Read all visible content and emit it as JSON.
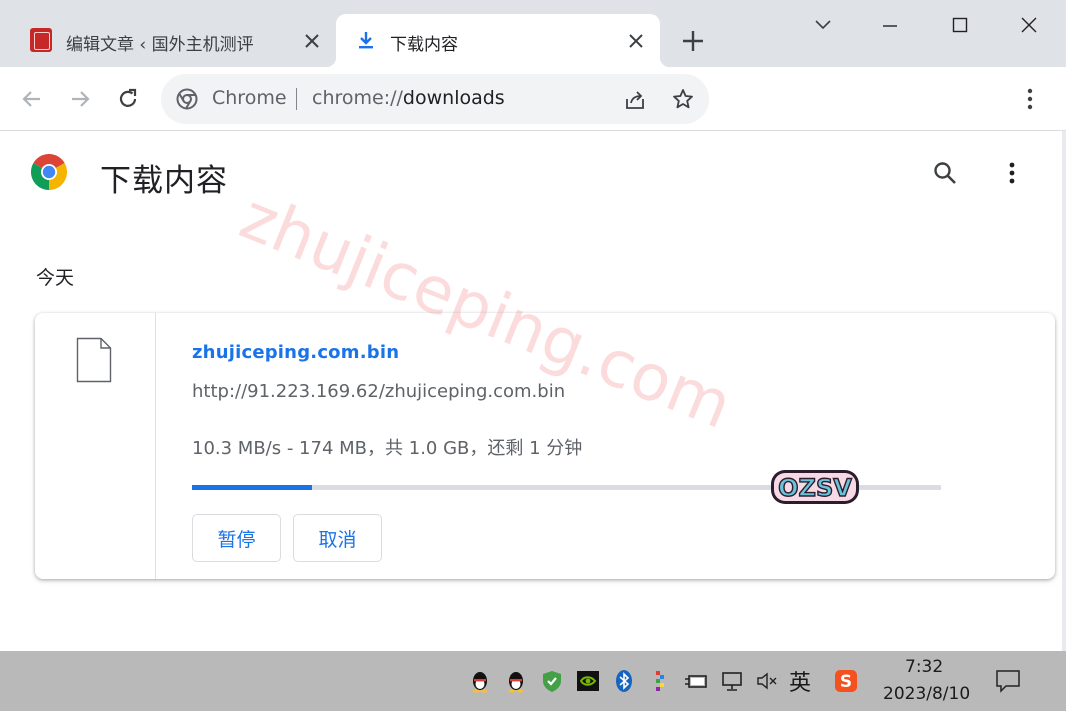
{
  "tabs": [
    {
      "title": "编辑文章 ‹ 国外主机测评",
      "active": false
    },
    {
      "title": "下载内容",
      "active": true
    }
  ],
  "omnibox": {
    "site_label": "Chrome",
    "url_scheme": "chrome://",
    "url_path": "downloads"
  },
  "page": {
    "title": "下载内容",
    "section_date": "今天"
  },
  "download": {
    "file_name": "zhujiceping.com.bin",
    "source_url": "http://91.223.169.62/zhujiceping.com.bin",
    "status": "10.3 MB/s - 174 MB，共 1.0 GB，还剩 1 分钟",
    "progress": 0.16,
    "pause_label": "暂停",
    "cancel_label": "取消"
  },
  "watermark": "zhujiceping.com",
  "sticker_text": "OZSV",
  "taskbar": {
    "ime": "英",
    "time": "7:32",
    "date": "2023/8/10"
  },
  "colors": {
    "accent": "#1a73e8",
    "tab_strip": "#dfe3e8",
    "taskbar": "#b9b9b9"
  },
  "icons": [
    "download-icon",
    "close-icon",
    "plus-icon",
    "back-arrow-icon",
    "forward-arrow-icon",
    "reload-icon",
    "share-icon",
    "star-icon",
    "kebab-menu-icon",
    "search-icon",
    "file-icon",
    "chrome-logo-icon"
  ]
}
